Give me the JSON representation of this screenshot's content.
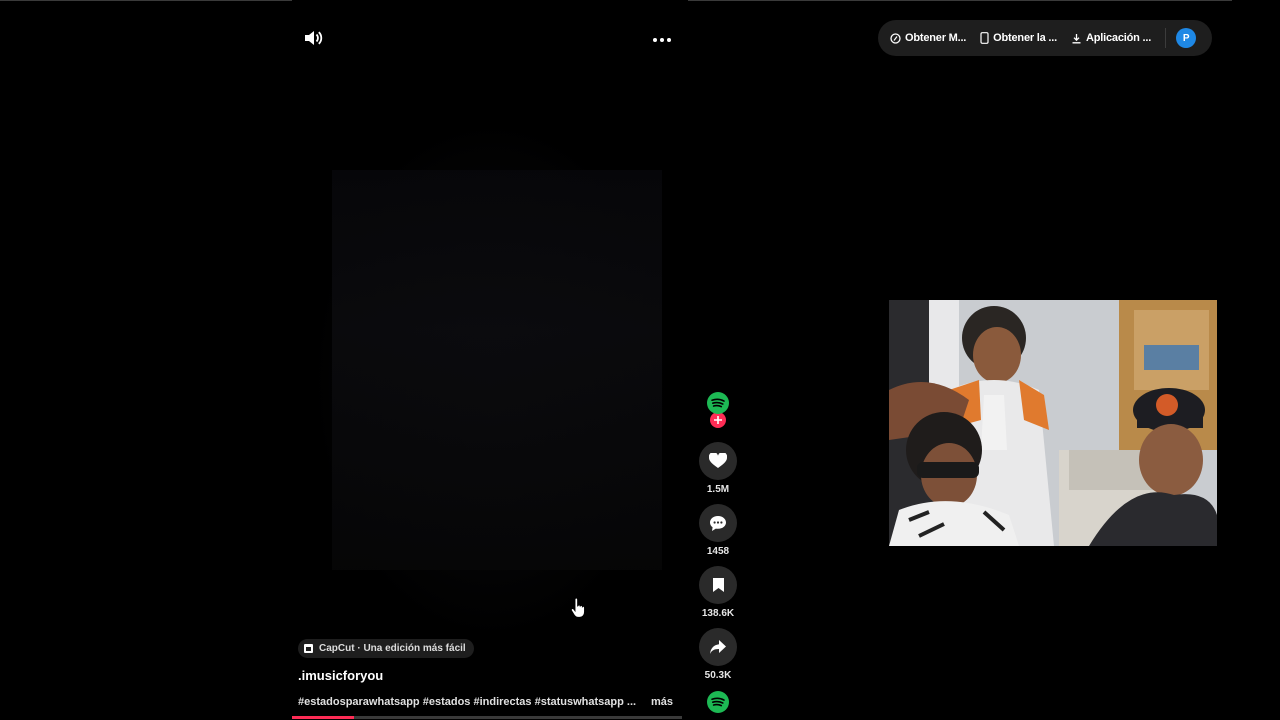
{
  "header": {
    "volume_icon": "speaker-icon",
    "more_icon": "ellipsis-icon",
    "pill": {
      "items": [
        {
          "label": "Obtener M...",
          "icon": "coin-icon"
        },
        {
          "label": "Obtener la ...",
          "icon": "phone-icon"
        },
        {
          "label": "Aplicación ...",
          "icon": "download-icon"
        }
      ],
      "avatar_letter": "P"
    }
  },
  "actions": {
    "likes": "1.5M",
    "comments": "1458",
    "saves": "138.6K",
    "shares": "50.3K"
  },
  "video": {
    "capcut_label": "CapCut · Una edición más fácil",
    "author": ".imusicforyou",
    "description": "#estadosparawhatsapp #estados #indirectas #statuswhatsapp ...",
    "more_label": "más",
    "progress": 0.16
  },
  "colors": {
    "spotify": "#1db954",
    "follow": "#fe2c55",
    "progress": "#fe2c55",
    "avatar": "#1e88e5"
  }
}
